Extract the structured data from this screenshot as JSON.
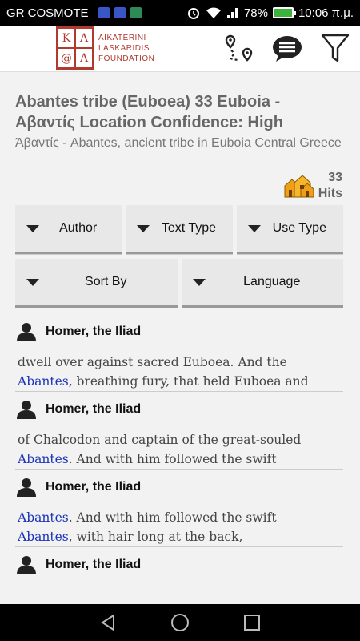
{
  "status_bar": {
    "carrier": "GR COSMOTE",
    "battery": "78%",
    "time": "10:06 π.μ."
  },
  "app_bar": {
    "logo_letters": [
      "Κ",
      "Λ",
      "@",
      "Λ"
    ],
    "logo_lines": [
      "AIKATERINI",
      "LASKARIDIS",
      "FOUNDATION"
    ],
    "icons": [
      "route-icon",
      "chat-icon",
      "filter-icon"
    ]
  },
  "place": {
    "title": "Abantes tribe (Euboea) 33 Euboia - Αβαντίς Location Confidence: High",
    "subtitle": "Άβαντίς - Abantes, ancient tribe in Euboia Central Greece",
    "hits_count": "33",
    "hits_label": "Hits"
  },
  "filters": {
    "row1": [
      "Author",
      "Text Type",
      "Use Type"
    ],
    "row2": [
      "Sort By",
      "Language"
    ]
  },
  "results": [
    {
      "author": "Homer, the Iliad",
      "lines": [
        {
          "pre": "dwell over against sacred Euboea. And the",
          "hl": "",
          "post": ""
        },
        {
          "pre": "",
          "hl": "Abantes",
          "post": ", breathing fury, that held Euboea and"
        }
      ]
    },
    {
      "author": "Homer, the Iliad",
      "lines": [
        {
          "pre": "of Chalcodon and captain of the great-souled",
          "hl": "",
          "post": ""
        },
        {
          "pre": "",
          "hl": "Abantes",
          "post": ". And with him followed the swift"
        }
      ]
    },
    {
      "author": "Homer, the Iliad",
      "lines": [
        {
          "pre": "",
          "hl": "Abantes",
          "post": ". And with him followed the swift"
        },
        {
          "pre": "",
          "hl": "Abantes",
          "post": ", with hair long at the back,"
        }
      ]
    },
    {
      "author": "Homer, the Iliad",
      "lines": []
    }
  ],
  "nav": [
    "back-icon",
    "home-icon",
    "recents-icon"
  ],
  "colors": {
    "highlight": "#1a33b8",
    "brand": "#b03a2e"
  }
}
